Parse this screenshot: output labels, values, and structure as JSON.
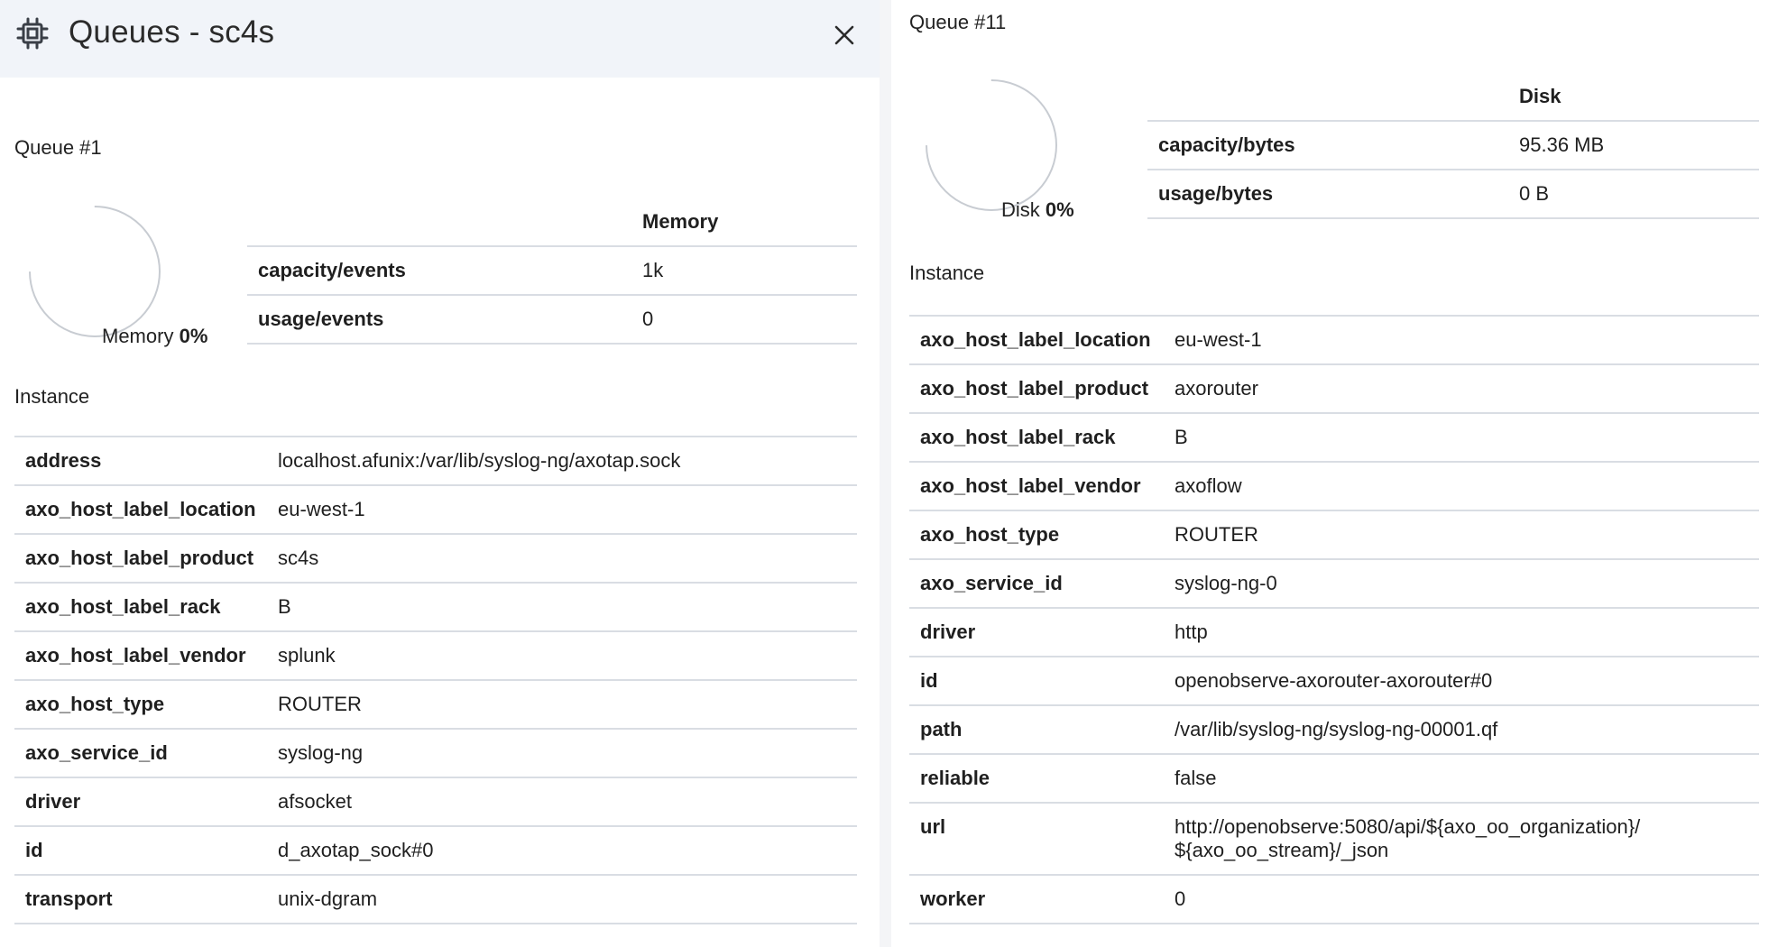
{
  "left": {
    "header_title": "Queues - sc4s",
    "queue_title": "Queue #1",
    "gauge": {
      "label": "Memory",
      "value": "0%",
      "fraction": 0
    },
    "usage": {
      "column_header": "Memory",
      "rows": [
        {
          "key": "capacity/events",
          "value": "1k"
        },
        {
          "key": "usage/events",
          "value": "0"
        }
      ]
    },
    "instance_label": "Instance",
    "instance": [
      {
        "key": "address",
        "value": "localhost.afunix:/var/lib/syslog-ng/axotap.sock"
      },
      {
        "key": "axo_host_label_location",
        "value": "eu-west-1"
      },
      {
        "key": "axo_host_label_product",
        "value": "sc4s"
      },
      {
        "key": "axo_host_label_rack",
        "value": "B"
      },
      {
        "key": "axo_host_label_vendor",
        "value": "splunk"
      },
      {
        "key": "axo_host_type",
        "value": "ROUTER"
      },
      {
        "key": "axo_service_id",
        "value": "syslog-ng"
      },
      {
        "key": "driver",
        "value": "afsocket"
      },
      {
        "key": "id",
        "value": "d_axotap_sock#0"
      },
      {
        "key": "transport",
        "value": "unix-dgram"
      }
    ]
  },
  "right": {
    "queue_title": "Queue #11",
    "gauge": {
      "label": "Disk",
      "value": "0%",
      "fraction": 0
    },
    "usage": {
      "column_header": "Disk",
      "rows": [
        {
          "key": "capacity/bytes",
          "value": "95.36 MB"
        },
        {
          "key": "usage/bytes",
          "value": "0 B"
        }
      ]
    },
    "instance_label": "Instance",
    "instance": [
      {
        "key": "axo_host_label_location",
        "value": "eu-west-1"
      },
      {
        "key": "axo_host_label_product",
        "value": "axorouter"
      },
      {
        "key": "axo_host_label_rack",
        "value": "B"
      },
      {
        "key": "axo_host_label_vendor",
        "value": "axoflow"
      },
      {
        "key": "axo_host_type",
        "value": "ROUTER"
      },
      {
        "key": "axo_service_id",
        "value": "syslog-ng-0"
      },
      {
        "key": "driver",
        "value": "http"
      },
      {
        "key": "id",
        "value": "openobserve-axorouter-axorouter#0"
      },
      {
        "key": "path",
        "value": "/var/lib/syslog-ng/syslog-ng-00001.qf"
      },
      {
        "key": "reliable",
        "value": "false"
      },
      {
        "key": "url",
        "value": [
          "http://openobserve:5080/api/${axo_oo_organization}/",
          "${axo_oo_stream}/_json"
        ]
      },
      {
        "key": "worker",
        "value": "0"
      }
    ]
  },
  "icons": {
    "header": "chip-icon",
    "close": "close-icon"
  },
  "colors": {
    "header_bg": "#f1f4f9",
    "divider": "#d9dde3",
    "gauge_track": "#c8ccd2"
  }
}
